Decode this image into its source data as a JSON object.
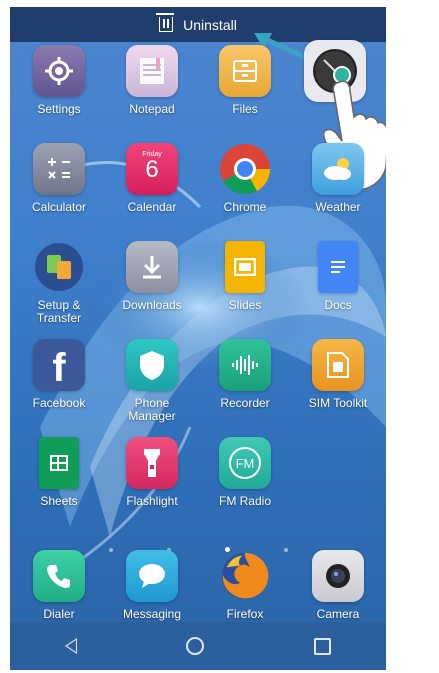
{
  "top_bar": {
    "uninstall_label": "Uninstall"
  },
  "apps": [
    {
      "label": "Settings",
      "icon": "gear-icon"
    },
    {
      "label": "Notepad",
      "icon": "notepad-icon"
    },
    {
      "label": "Files",
      "icon": "files-icon"
    },
    {
      "label": "",
      "icon": "clock-icon"
    },
    {
      "label": "Calculator",
      "icon": "calculator-icon"
    },
    {
      "label": "Calendar",
      "icon": "calendar-icon",
      "day": "Friday",
      "date": "6"
    },
    {
      "label": "Chrome",
      "icon": "chrome-icon"
    },
    {
      "label": "Weather",
      "icon": "weather-icon"
    },
    {
      "label": "Setup & Transfer",
      "icon": "setup-transfer-icon"
    },
    {
      "label": "Downloads",
      "icon": "download-icon"
    },
    {
      "label": "Slides",
      "icon": "slides-icon"
    },
    {
      "label": "Docs",
      "icon": "docs-icon"
    },
    {
      "label": "Facebook",
      "icon": "facebook-icon",
      "glyph": "f"
    },
    {
      "label": "Phone Manager",
      "icon": "shield-icon"
    },
    {
      "label": "Recorder",
      "icon": "recorder-icon"
    },
    {
      "label": "SIM Toolkit",
      "icon": "sim-icon"
    },
    {
      "label": "Sheets",
      "icon": "sheets-icon"
    },
    {
      "label": "Flashlight",
      "icon": "flashlight-icon"
    },
    {
      "label": "FM Radio",
      "icon": "radio-icon",
      "glyph": "FM"
    }
  ],
  "dock": [
    {
      "label": "Dialer",
      "icon": "phone-icon"
    },
    {
      "label": "Messaging",
      "icon": "message-icon"
    },
    {
      "label": "Firefox",
      "icon": "firefox-icon"
    },
    {
      "label": "Camera",
      "icon": "camera-icon"
    }
  ],
  "page_indicator": {
    "count": 4,
    "active_index": 2
  },
  "nav": {
    "back": "back-icon",
    "home": "home-icon",
    "recents": "recents-icon"
  }
}
